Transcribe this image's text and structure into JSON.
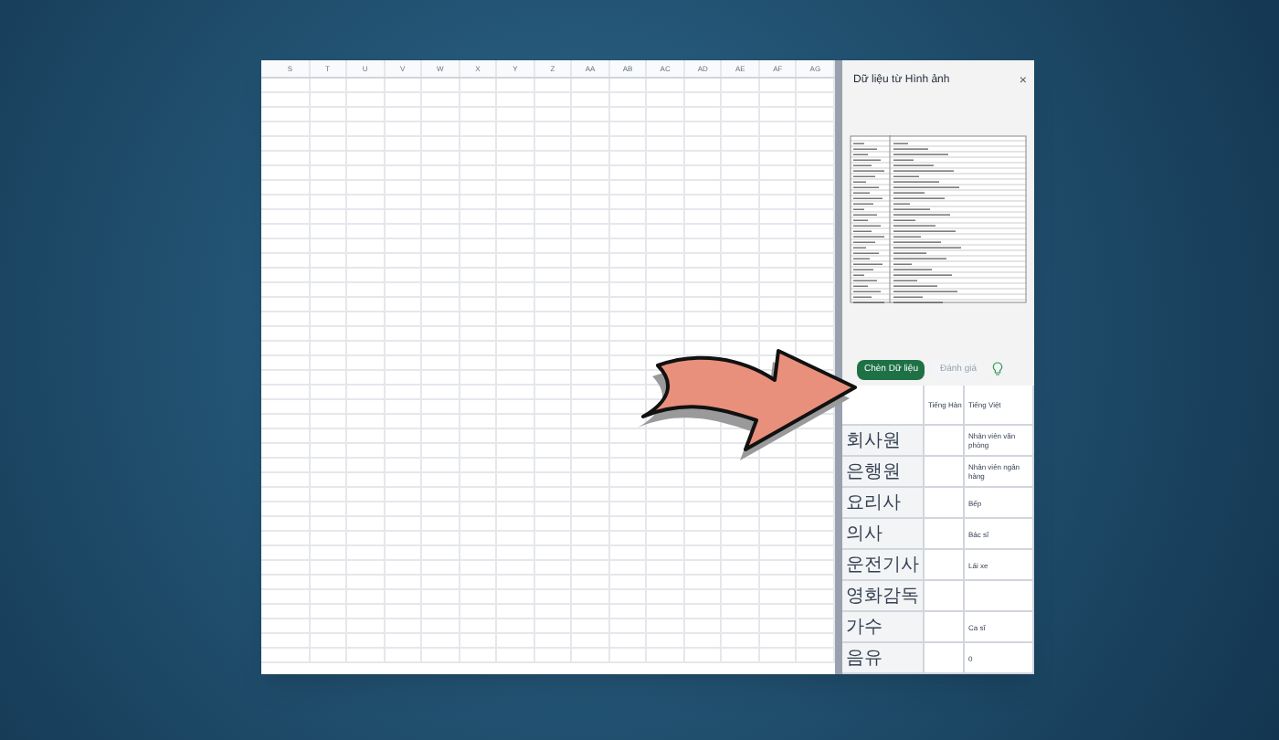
{
  "sheet": {
    "columns": [
      "S",
      "T",
      "U",
      "V",
      "W",
      "X",
      "Y",
      "Z",
      "AA",
      "AB",
      "AC",
      "AD",
      "AE",
      "AF",
      "AG"
    ]
  },
  "panel": {
    "title": "Dữ liệu từ Hình ảnh",
    "close": "×",
    "buttons": [
      {
        "label": "Chèn Dữ liệu",
        "disabled": false
      },
      {
        "label": "Đánh giá",
        "disabled": true
      }
    ],
    "table": {
      "columns": [
        "",
        "Tiếng Hàn",
        "Tiếng Việt"
      ],
      "rows": [
        [
          "회사원",
          "",
          "Nhân viên văn phòng"
        ],
        [
          "은행원",
          "",
          "Nhân viên ngân hàng"
        ],
        [
          "요리사",
          "",
          "Bếp"
        ],
        [
          "의사",
          "",
          "Bác sĩ"
        ],
        [
          "운전기사",
          "",
          "Lái xe"
        ],
        [
          "영화감독",
          "",
          ""
        ],
        [
          "가수",
          "",
          "Ca sĩ"
        ],
        [
          "음유",
          "",
          "0"
        ]
      ]
    }
  }
}
